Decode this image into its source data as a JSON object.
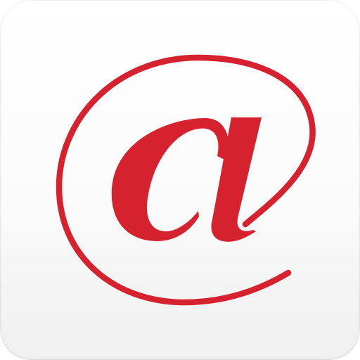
{
  "icon": {
    "glyph_name": "at-sign-icon",
    "colors": {
      "accent": "#d6212f",
      "background_top": "#ffffff",
      "background_bottom": "#efefef"
    }
  }
}
